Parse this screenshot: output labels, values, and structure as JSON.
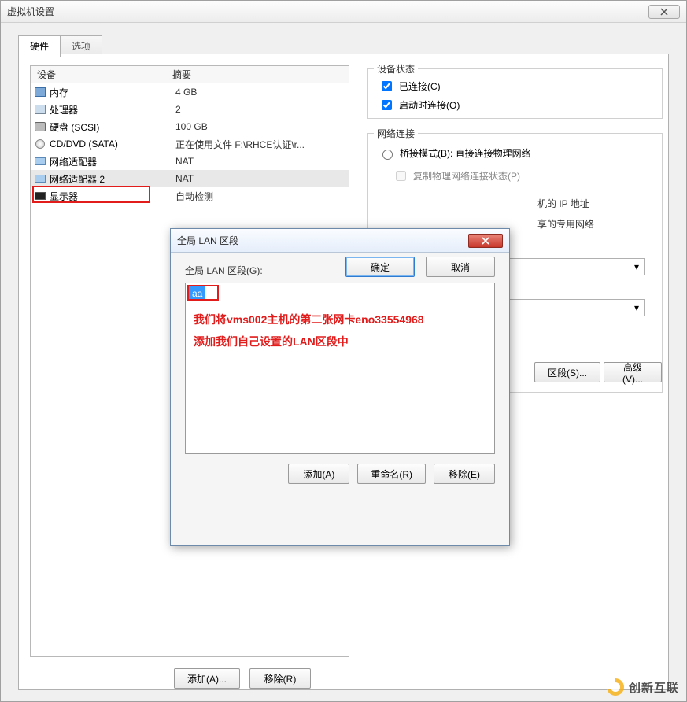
{
  "window": {
    "title": "虚拟机设置"
  },
  "tabs": {
    "hardware": "硬件",
    "options": "选项"
  },
  "devlist": {
    "head_device": "设备",
    "head_summary": "摘要",
    "rows": [
      {
        "label": "内存",
        "summary": "4 GB"
      },
      {
        "label": "处理器",
        "summary": "2"
      },
      {
        "label": "硬盘 (SCSI)",
        "summary": "100 GB"
      },
      {
        "label": "CD/DVD (SATA)",
        "summary": "正在使用文件 F:\\RHCE认证\\r..."
      },
      {
        "label": "网络适配器",
        "summary": "NAT"
      },
      {
        "label": "网络适配器 2",
        "summary": "NAT"
      },
      {
        "label": "显示器",
        "summary": "自动检测"
      }
    ]
  },
  "main_buttons": {
    "add": "添加(A)...",
    "remove": "移除(R)"
  },
  "state": {
    "legend": "设备状态",
    "connected": "已连接(C)",
    "connect_at_power": "启动时连接(O)"
  },
  "net": {
    "legend": "网络连接",
    "bridge": "桥接模式(B): 直接连接物理网络",
    "replicate": "复制物理网络连接状态(P)",
    "ip_tail": "机的 IP 地址",
    "private_tail": "享的专用网络",
    "lan_seg_btn": "区段(S)...",
    "advanced_btn": "高级(V)..."
  },
  "dialog": {
    "title": "全局 LAN 区段",
    "label": "全局 LAN 区段(G):",
    "item": "aa",
    "anno1": "我们将vms002主机的第二张网卡eno33554968",
    "anno2": "添加我们自己设置的LAN区段中",
    "add": "添加(A)",
    "rename": "重命名(R)",
    "remove": "移除(E)",
    "ok": "确定",
    "cancel": "取消"
  },
  "watermark": "创新互联"
}
